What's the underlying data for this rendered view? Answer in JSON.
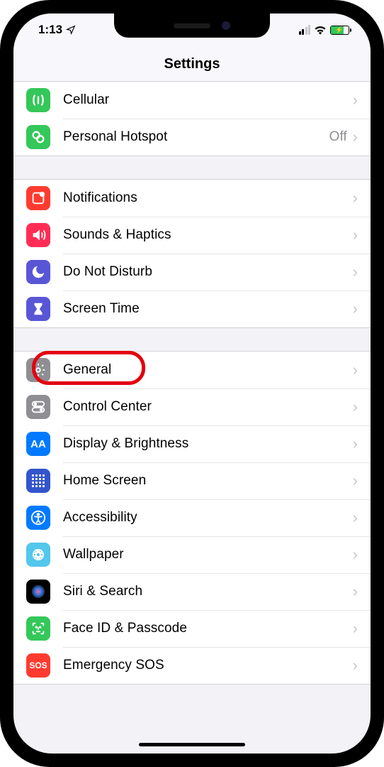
{
  "status": {
    "time": "1:13"
  },
  "header": {
    "title": "Settings"
  },
  "groups": [
    {
      "items": [
        {
          "id": "cellular",
          "label": "Cellular"
        },
        {
          "id": "hotspot",
          "label": "Personal Hotspot",
          "detail": "Off"
        }
      ]
    },
    {
      "items": [
        {
          "id": "notifications",
          "label": "Notifications"
        },
        {
          "id": "sounds",
          "label": "Sounds & Haptics"
        },
        {
          "id": "dnd",
          "label": "Do Not Disturb"
        },
        {
          "id": "screentime",
          "label": "Screen Time"
        }
      ]
    },
    {
      "items": [
        {
          "id": "general",
          "label": "General",
          "highlighted": true
        },
        {
          "id": "controlcenter",
          "label": "Control Center"
        },
        {
          "id": "display",
          "label": "Display & Brightness"
        },
        {
          "id": "homescreen",
          "label": "Home Screen"
        },
        {
          "id": "accessibility",
          "label": "Accessibility"
        },
        {
          "id": "wallpaper",
          "label": "Wallpaper"
        },
        {
          "id": "siri",
          "label": "Siri & Search"
        },
        {
          "id": "faceid",
          "label": "Face ID & Passcode"
        },
        {
          "id": "sos",
          "label": "Emergency SOS"
        }
      ]
    }
  ],
  "icons": {
    "cellular": {
      "bg": "#34c759"
    },
    "hotspot": {
      "bg": "#34c759"
    },
    "notifications": {
      "bg": "#ff3b30"
    },
    "sounds": {
      "bg": "#ff2d55"
    },
    "dnd": {
      "bg": "#5856d6"
    },
    "screentime": {
      "bg": "#5856d6"
    },
    "general": {
      "bg": "#8e8e93"
    },
    "controlcenter": {
      "bg": "#8e8e93"
    },
    "display": {
      "bg": "#007aff"
    },
    "homescreen": {
      "bg": "#3355cc"
    },
    "accessibility": {
      "bg": "#007aff"
    },
    "wallpaper": {
      "bg": "#54c7ec"
    },
    "siri": {
      "bg": "#000"
    },
    "faceid": {
      "bg": "#34c759"
    },
    "sos": {
      "bg": "#ff3b30",
      "text": "SOS"
    }
  }
}
